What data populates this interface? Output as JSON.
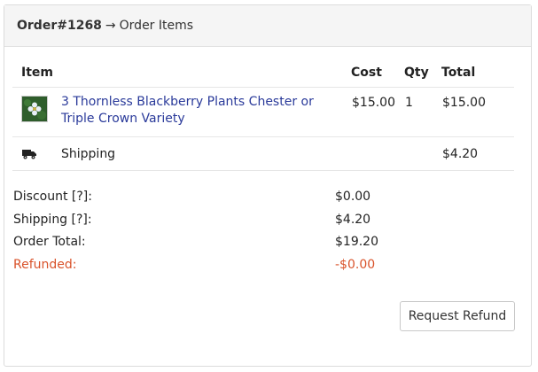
{
  "header": {
    "order_number": "Order#1268",
    "arrow": "→",
    "title": "Order Items"
  },
  "table": {
    "columns": [
      "Item",
      "Cost",
      "Qty",
      "Total"
    ],
    "items": [
      {
        "name": "3 Thornless Blackberry Plants Chester or Triple Crown Variety",
        "cost": "$15.00",
        "qty": "1",
        "total": "$15.00",
        "thumbnail_icon": "flower-thumbnail"
      }
    ],
    "shipping": {
      "icon": "truck-icon",
      "label": "Shipping",
      "total": "$4.20"
    }
  },
  "summary": {
    "discount_label": "Discount [?]:",
    "discount_value": "$0.00",
    "shipping_label": "Shipping [?]:",
    "shipping_value": "$4.20",
    "order_total_label": "Order Total:",
    "order_total_value": "$19.20",
    "refunded_label": "Refunded:",
    "refunded_value": "-$0.00"
  },
  "actions": {
    "request_refund_label": "Request Refund"
  },
  "colors": {
    "link": "#2a3a9a",
    "refund": "#d9532b"
  }
}
